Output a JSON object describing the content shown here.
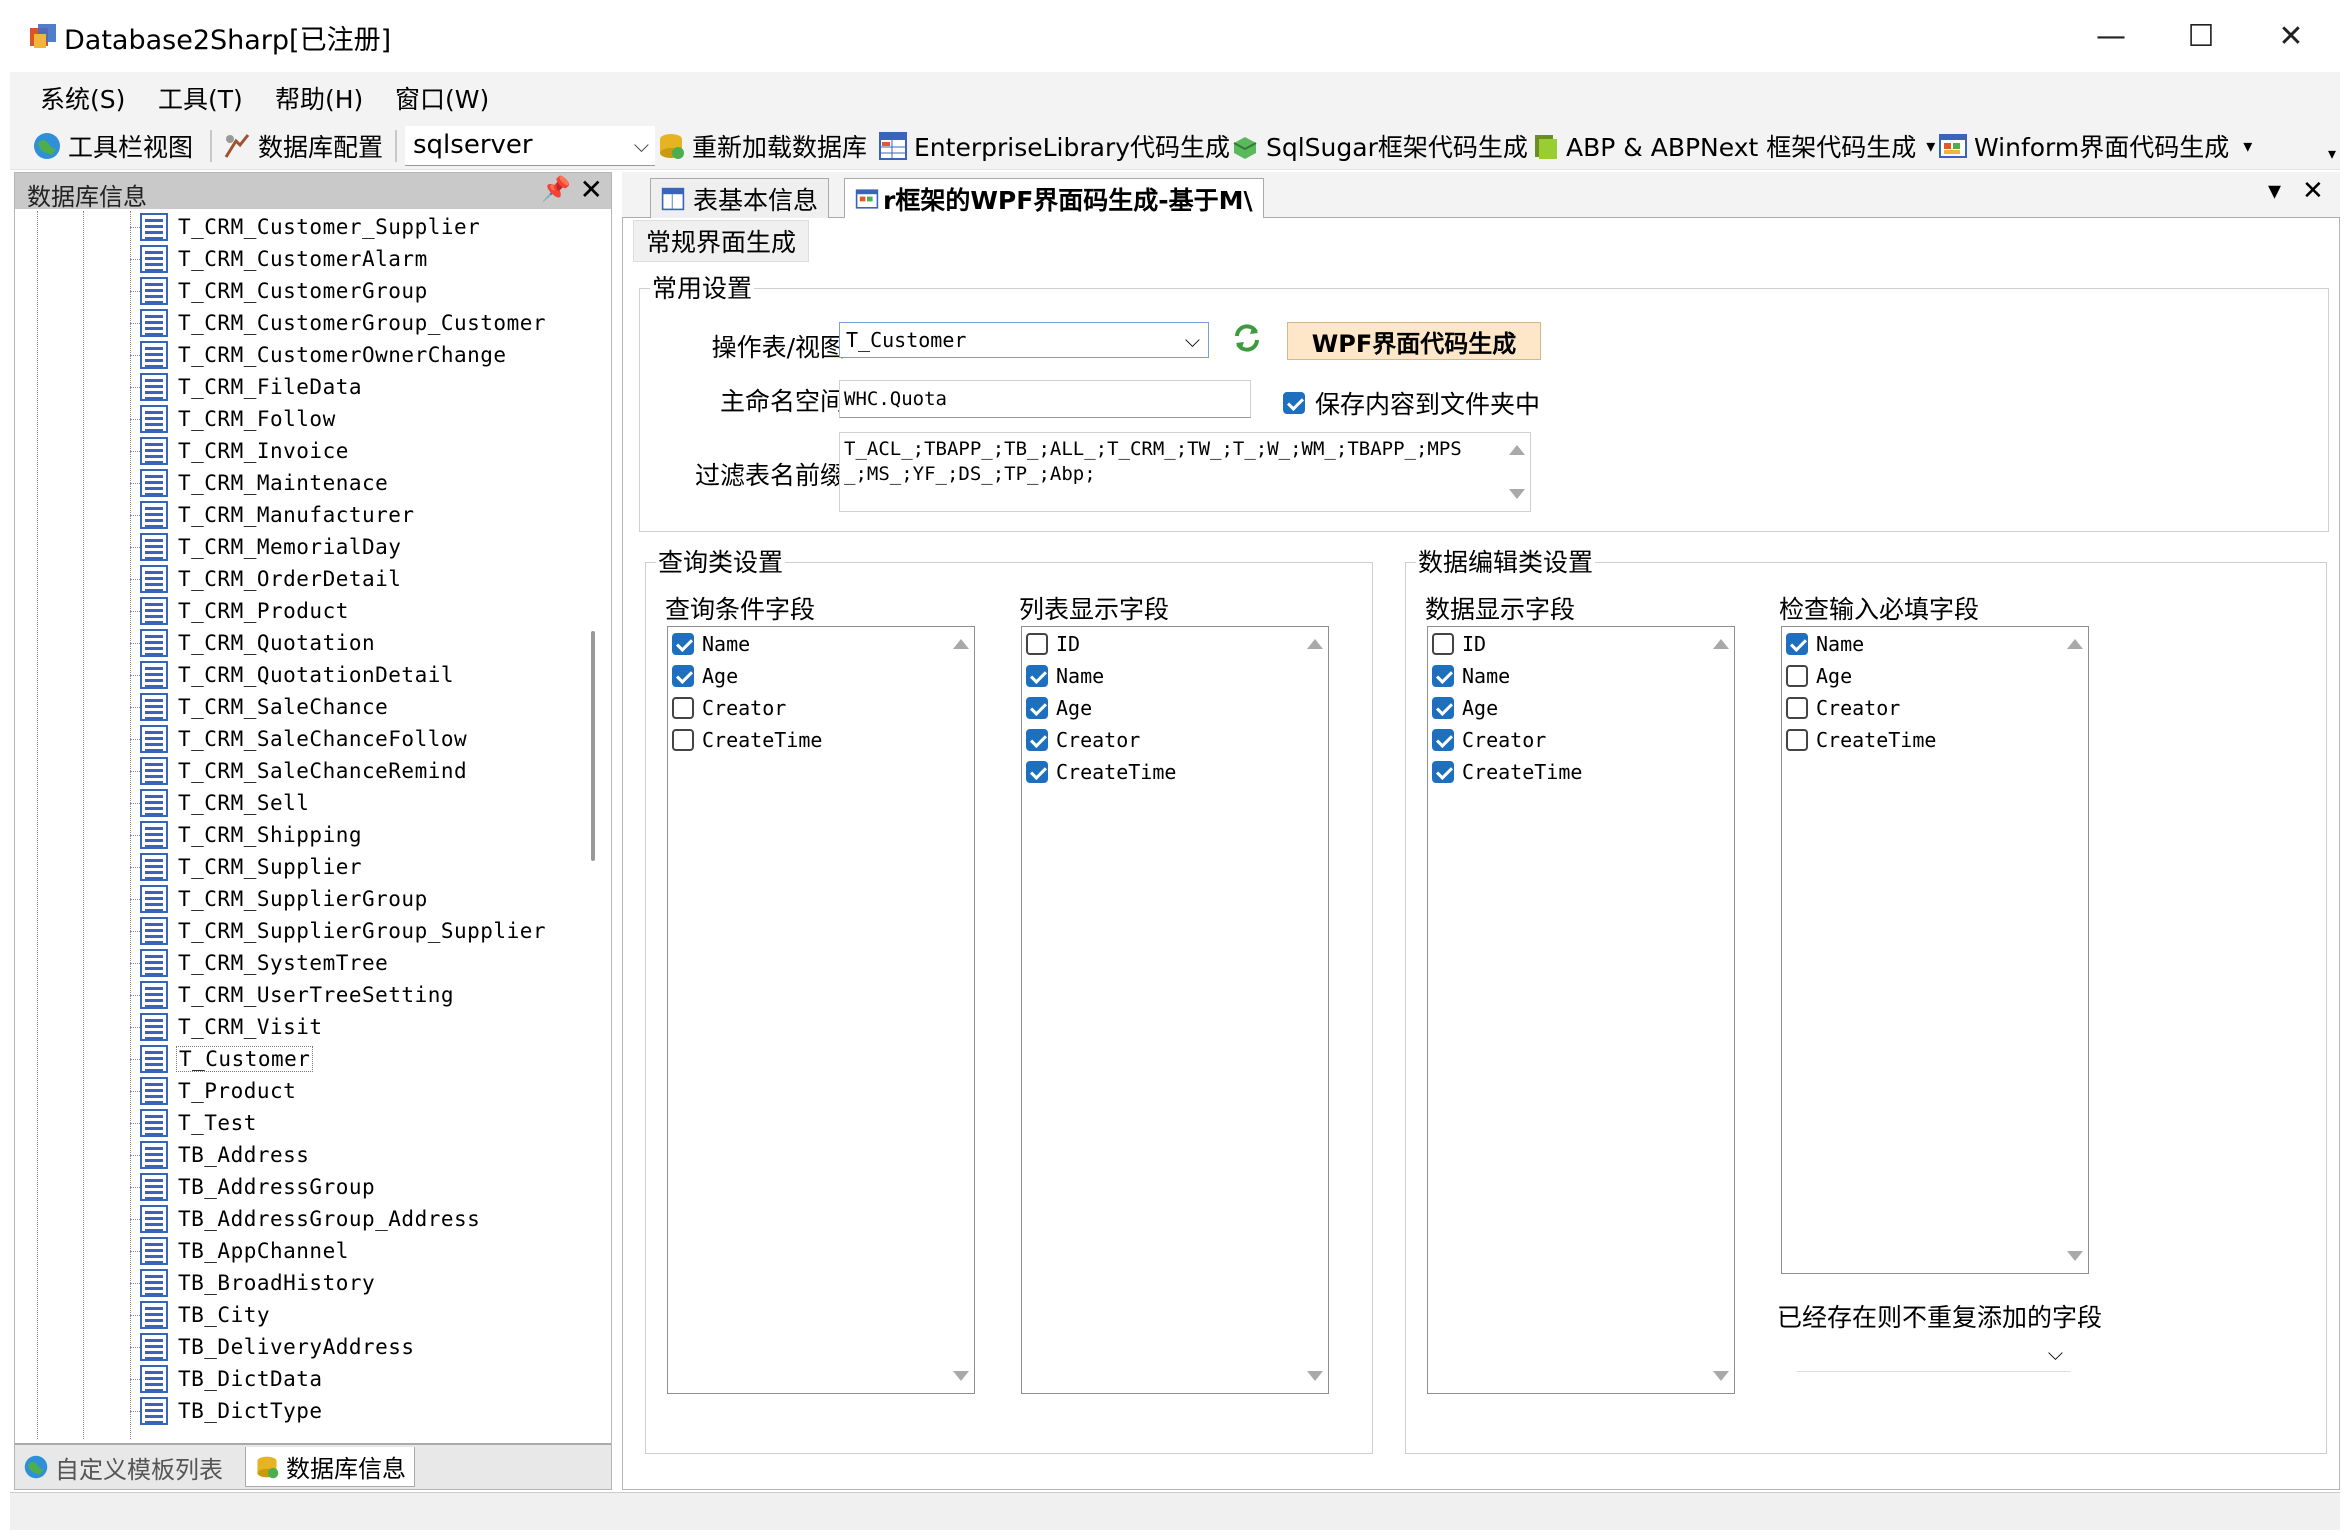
{
  "window": {
    "title": "Database2Sharp[已注册]",
    "minimize": "—",
    "maximize": "☐",
    "close": "✕"
  },
  "menu": [
    "系统(S)",
    "工具(T)",
    "帮助(H)",
    "窗口(W)"
  ],
  "toolbar": {
    "toolbar_view": "工具栏视图",
    "db_config": "数据库配置",
    "db_type": "sqlserver",
    "reload": "重新加载数据库",
    "enterprise_lib": "EnterpriseLibrary代码生成",
    "sqlsugar": "SqlSugar框架代码生成",
    "abp": "ABP & ABPNext 框架代码生成",
    "winform": "Winform界面代码生成",
    "dropdown_arrow": "▾"
  },
  "left_panel": {
    "title": "数据库信息",
    "pin": "ꟼ",
    "close": "✕",
    "tables": [
      "T_CRM_Customer_Supplier",
      "T_CRM_CustomerAlarm",
      "T_CRM_CustomerGroup",
      "T_CRM_CustomerGroup_Customer",
      "T_CRM_CustomerOwnerChange",
      "T_CRM_FileData",
      "T_CRM_Follow",
      "T_CRM_Invoice",
      "T_CRM_Maintenace",
      "T_CRM_Manufacturer",
      "T_CRM_MemorialDay",
      "T_CRM_OrderDetail",
      "T_CRM_Product",
      "T_CRM_Quotation",
      "T_CRM_QuotationDetail",
      "T_CRM_SaleChance",
      "T_CRM_SaleChanceFollow",
      "T_CRM_SaleChanceRemind",
      "T_CRM_Sell",
      "T_CRM_Shipping",
      "T_CRM_Supplier",
      "T_CRM_SupplierGroup",
      "T_CRM_SupplierGroup_Supplier",
      "T_CRM_SystemTree",
      "T_CRM_UserTreeSetting",
      "T_CRM_Visit",
      "T_Customer",
      "T_Product",
      "T_Test",
      "TB_Address",
      "TB_AddressGroup",
      "TB_AddressGroup_Address",
      "TB_AppChannel",
      "TB_BroadHistory",
      "TB_City",
      "TB_DeliveryAddress",
      "TB_DictData",
      "TB_DictType"
    ],
    "selected_table": "T_Customer",
    "bottom_tabs": [
      "自定义模板列表",
      "数据库信息"
    ]
  },
  "doc_tabs": {
    "tab1": "表基本信息",
    "tab2": "r框架的WPF界面码生成-基于M\\",
    "menu": "▾",
    "close": "✕"
  },
  "form": {
    "subtab": "常规界面生成",
    "common_group": "常用设置",
    "table_label": "操作表/视图",
    "table_value": "T_Customer",
    "generate_button": "WPF界面代码生成",
    "namespace_label": "主命名空间",
    "namespace_value": "WHC.Quota",
    "save_to_folder_label": "保存内容到文件夹中",
    "save_to_folder_checked": true,
    "prefix_label": "过滤表名前缀",
    "prefix_value": "T_ACL_;TBAPP_;TB_;ALL_;T_CRM_;TW_;T_;W_;WM_;TBAPP_;MPS_;MS_;YF_;DS_;TP_;Abp;",
    "query_group": "查询类设置",
    "edit_group": "数据编辑类设置",
    "query_fields": {
      "title": "查询条件字段",
      "items": [
        {
          "name": "Name",
          "checked": true
        },
        {
          "name": "Age",
          "checked": true
        },
        {
          "name": "Creator",
          "checked": false
        },
        {
          "name": "CreateTime",
          "checked": false
        }
      ]
    },
    "list_fields": {
      "title": "列表显示字段",
      "items": [
        {
          "name": "ID",
          "checked": false
        },
        {
          "name": "Name",
          "checked": true
        },
        {
          "name": "Age",
          "checked": true
        },
        {
          "name": "Creator",
          "checked": true
        },
        {
          "name": "CreateTime",
          "checked": true
        }
      ]
    },
    "display_fields": {
      "title": "数据显示字段",
      "items": [
        {
          "name": "ID",
          "checked": false
        },
        {
          "name": "Name",
          "checked": true
        },
        {
          "name": "Age",
          "checked": true
        },
        {
          "name": "Creator",
          "checked": true
        },
        {
          "name": "CreateTime",
          "checked": true
        }
      ]
    },
    "required_fields": {
      "title": "检查输入必填字段",
      "items": [
        {
          "name": "Name",
          "checked": true
        },
        {
          "name": "Age",
          "checked": false
        },
        {
          "name": "Creator",
          "checked": false
        },
        {
          "name": "CreateTime",
          "checked": false
        }
      ]
    },
    "unique_fields_label": "已经存在则不重复添加的字段",
    "unique_fields_value": ""
  }
}
